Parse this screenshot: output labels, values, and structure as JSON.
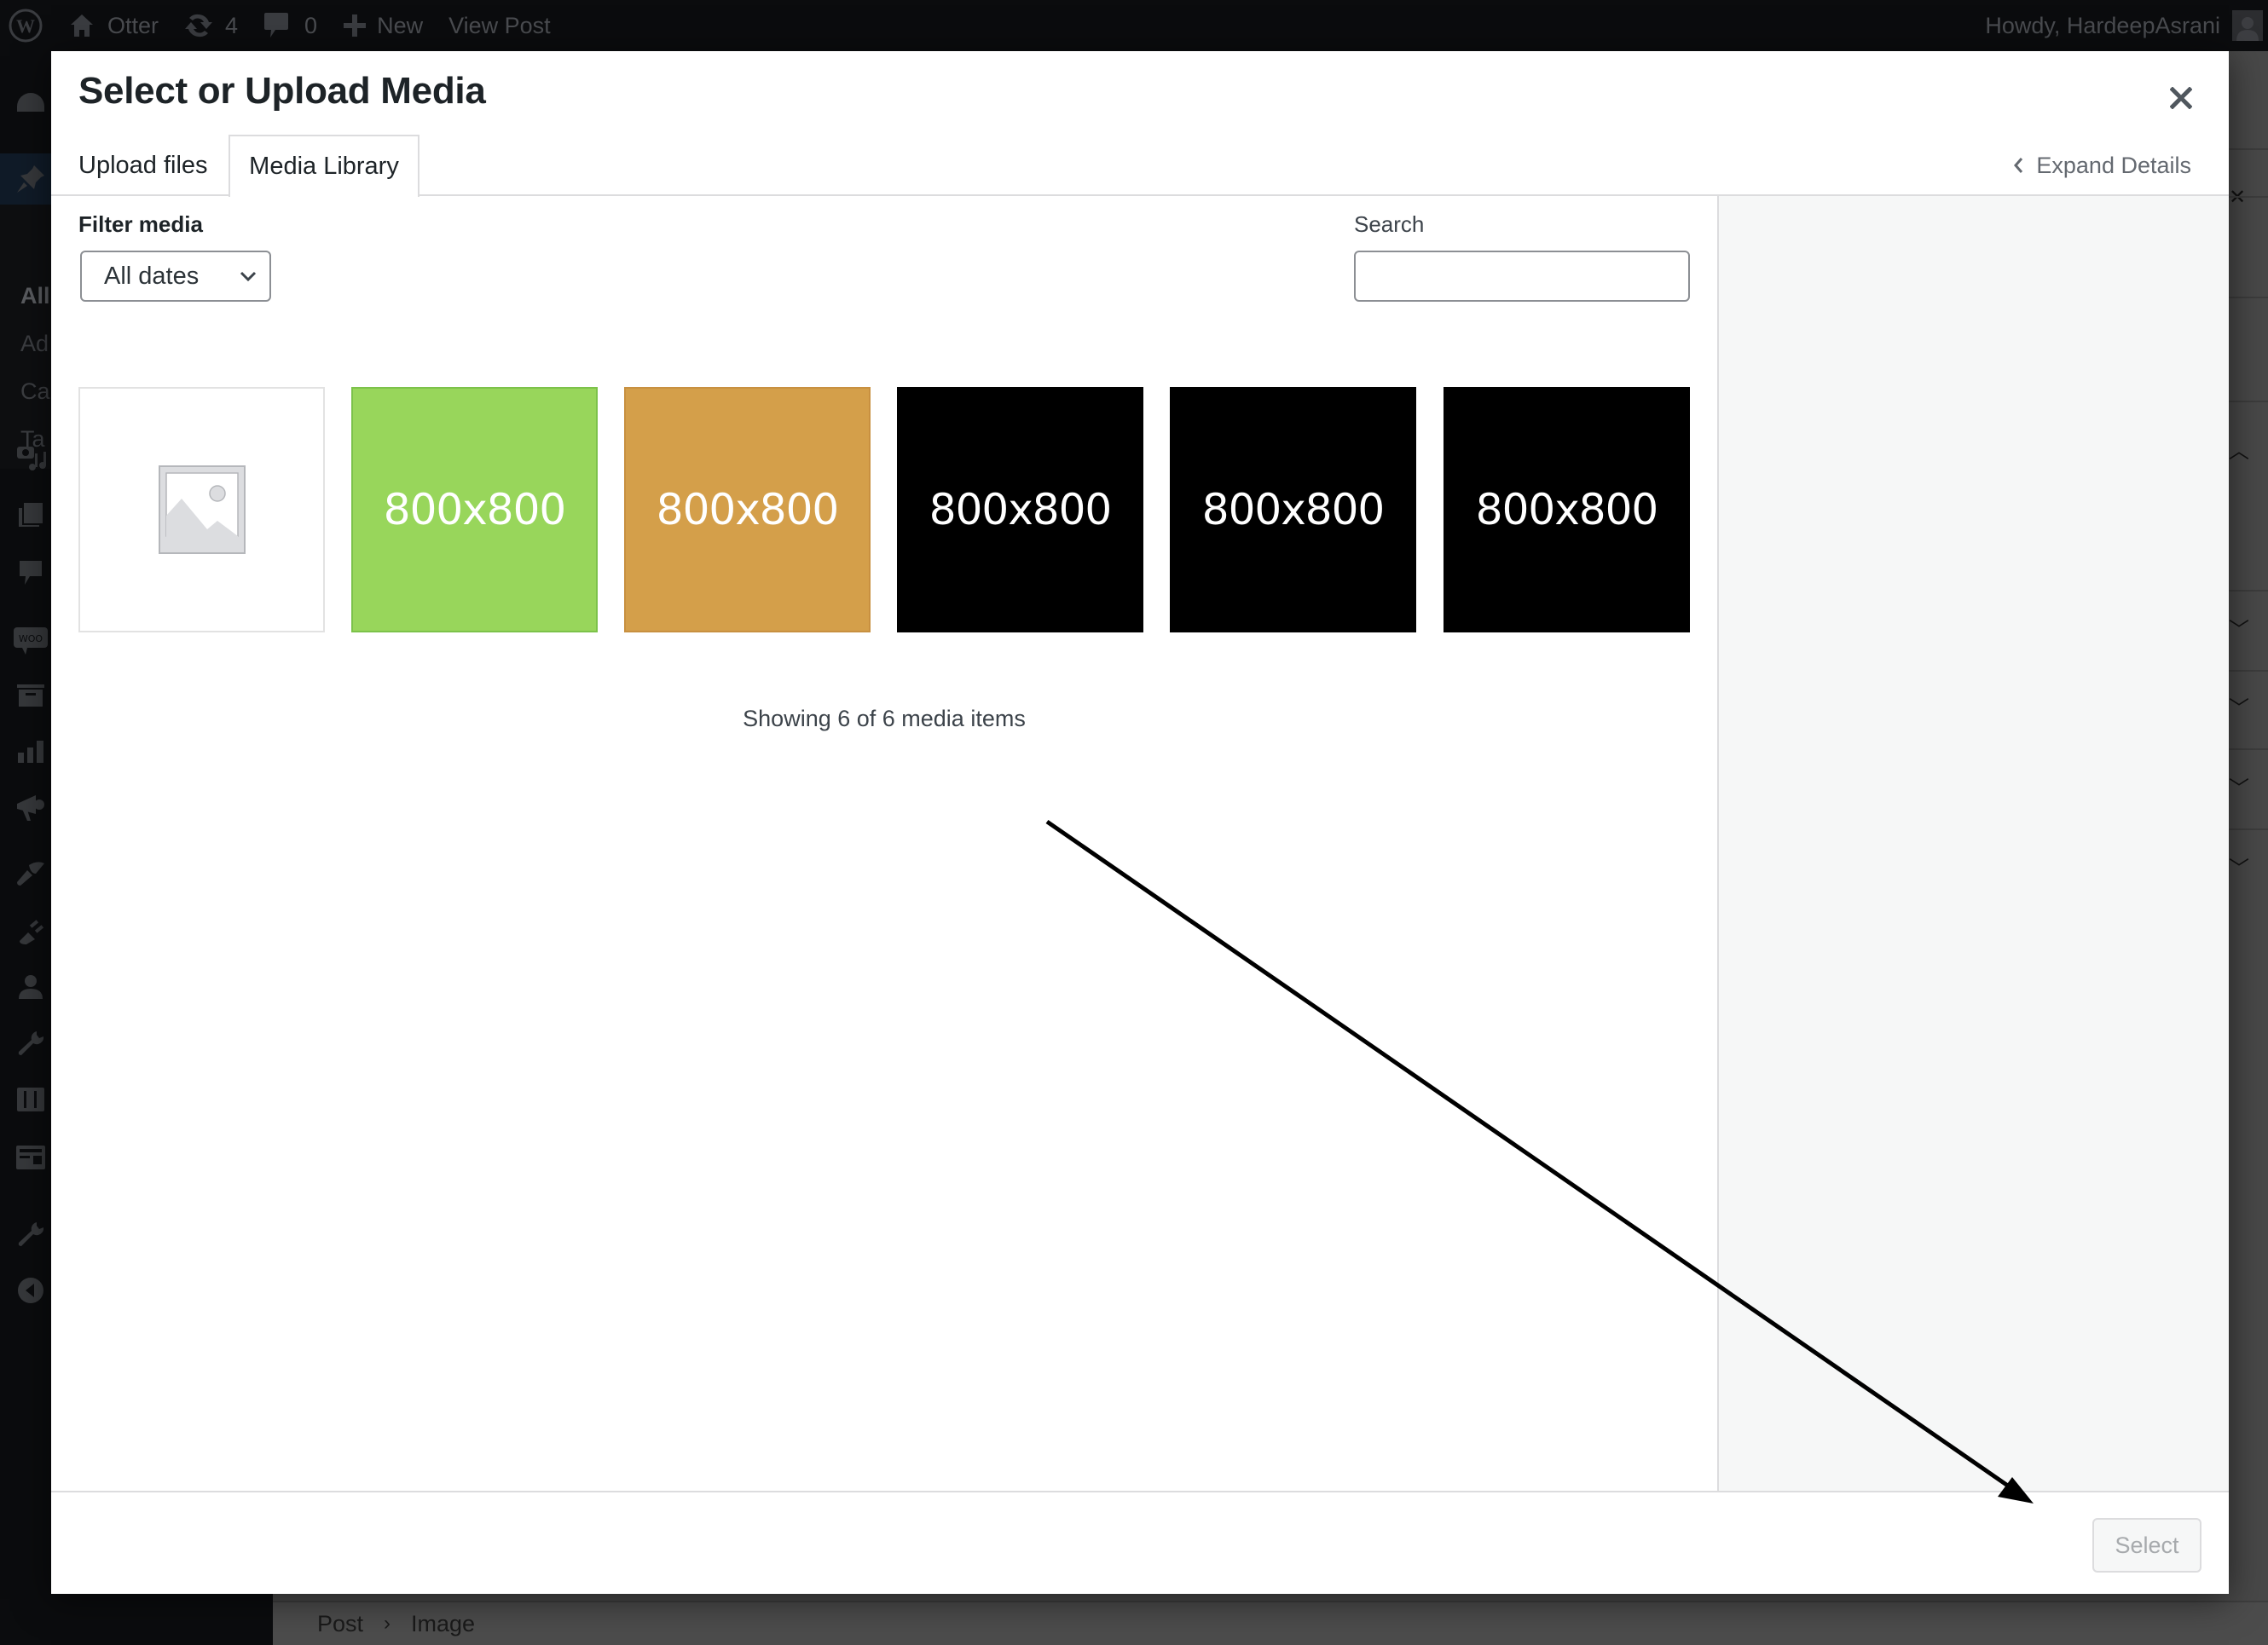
{
  "adminbar": {
    "site_name": "Otter",
    "updates_count": "4",
    "comments_count": "0",
    "new_label": "New",
    "view_post_label": "View Post",
    "greeting": "Howdy, HardeepAsrani",
    "icons": [
      "wordpress-logo-icon",
      "home-icon",
      "updates-icon",
      "comment-icon",
      "plus-icon",
      "avatar-icon"
    ]
  },
  "sidebar": {
    "submenu": [
      "All",
      "Ad",
      "Ca",
      "Ta"
    ],
    "icons": [
      "dashboard-icon",
      "pin-icon",
      "media-icon",
      "pages-icon",
      "comments-icon",
      "woo-icon",
      "products-icon",
      "analytics-icon",
      "marketing-icon",
      "appearance-icon",
      "plugins-icon",
      "users-icon",
      "tools-icon",
      "settings-icon",
      "layout-icon",
      "wrench-icon",
      "collapse-icon"
    ]
  },
  "modal": {
    "title": "Select or Upload Media",
    "close_icon": "close-icon",
    "tabs": [
      {
        "label": "Upload files",
        "active": false
      },
      {
        "label": "Media Library",
        "active": true
      }
    ],
    "expand_details_label": "Expand Details",
    "filter": {
      "label": "Filter media",
      "selected": "All dates"
    },
    "search": {
      "label": "Search",
      "value": "",
      "placeholder": ""
    },
    "media_items": [
      {
        "type": "placeholder",
        "label": "",
        "color": "#ffffff"
      },
      {
        "type": "image",
        "label": "800x800",
        "color": "#98d65b"
      },
      {
        "type": "image",
        "label": "800x800",
        "color": "#d49f4a"
      },
      {
        "type": "image",
        "label": "800x800",
        "color": "#000000"
      },
      {
        "type": "image",
        "label": "800x800",
        "color": "#000000"
      },
      {
        "type": "image",
        "label": "800x800",
        "color": "#000000"
      }
    ],
    "count_text": "Showing 6 of 6 media items",
    "select_button_label": "Select",
    "select_button_disabled": true
  },
  "breadcrumb": [
    "Post",
    "Image"
  ],
  "colors": {
    "overlay": "#4a4a4a",
    "adminbar": "#0b0c0e",
    "details_sidebar": "#f6f7f7",
    "border": "#dcdcde",
    "muted_text": "#646970"
  }
}
